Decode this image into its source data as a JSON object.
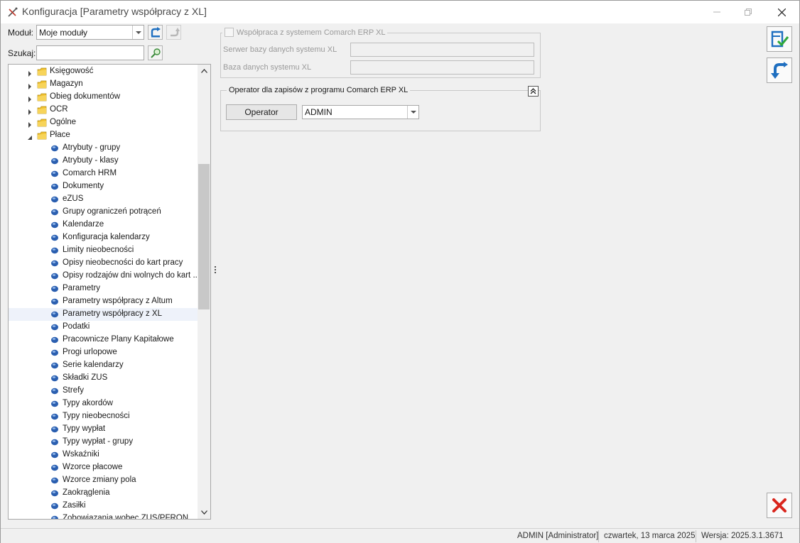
{
  "window": {
    "title": "Konfiguracja [Parametry współpracy z XL]"
  },
  "toolbar": {
    "module_label": "Moduł:",
    "module_value": "Moje moduły",
    "search_label": "Szukaj:",
    "search_value": ""
  },
  "tree": {
    "categories": [
      {
        "label": "Księgowość",
        "expanded": false
      },
      {
        "label": "Magazyn",
        "expanded": false
      },
      {
        "label": "Obieg dokumentów",
        "expanded": false
      },
      {
        "label": "OCR",
        "expanded": false
      },
      {
        "label": "Ogólne",
        "expanded": false
      },
      {
        "label": "Płace",
        "expanded": true
      }
    ],
    "items": [
      "Atrybuty - grupy",
      "Atrybuty - klasy",
      "Comarch HRM",
      "Dokumenty",
      "eZUS",
      "Grupy ograniczeń potrąceń",
      "Kalendarze",
      "Konfiguracja kalendarzy",
      "Limity nieobecności",
      "Opisy nieobecności do kart pracy",
      "Opisy rodzajów dni wolnych do kart ...",
      "Parametry",
      "Parametry współpracy z Altum",
      "Parametry współpracy z XL",
      "Podatki",
      "Pracownicze Plany Kapitałowe",
      "Progi urlopowe",
      "Serie kalendarzy",
      "Składki ZUS",
      "Strefy",
      "Typy akordów",
      "Typy nieobecności",
      "Typy wypłat",
      "Typy wypłat - grupy",
      "Wskaźniki",
      "Wzorce płacowe",
      "Wzorce zmiany pola",
      "Zaokrąglenia",
      "Zasiłki",
      "Zobowiązania wobec ZUS/PFRON"
    ],
    "selected_index": 13
  },
  "erp_group": {
    "checkbox_label": "Współpraca z systemem Comarch ERP XL",
    "checked": false,
    "server_label": "Serwer bazy danych systemu XL",
    "server_value": "",
    "db_label": "Baza danych systemu XL",
    "db_value": ""
  },
  "operator_group": {
    "title": "Operator dla zapisów z programu Comarch ERP XL",
    "button_label": "Operator",
    "operator_value": "ADMIN"
  },
  "statusbar": {
    "user": "ADMIN [Administrator]",
    "date": "czwartek, 13 marca 2025",
    "version": "Wersja: 2025.3.1.3671"
  },
  "colors": {
    "folder": "#f2c230",
    "leaf": "#2b5fb0",
    "accent_blue": "#1f6fc0",
    "close_red": "#d9251c",
    "selected_row": "#eef2fa"
  }
}
